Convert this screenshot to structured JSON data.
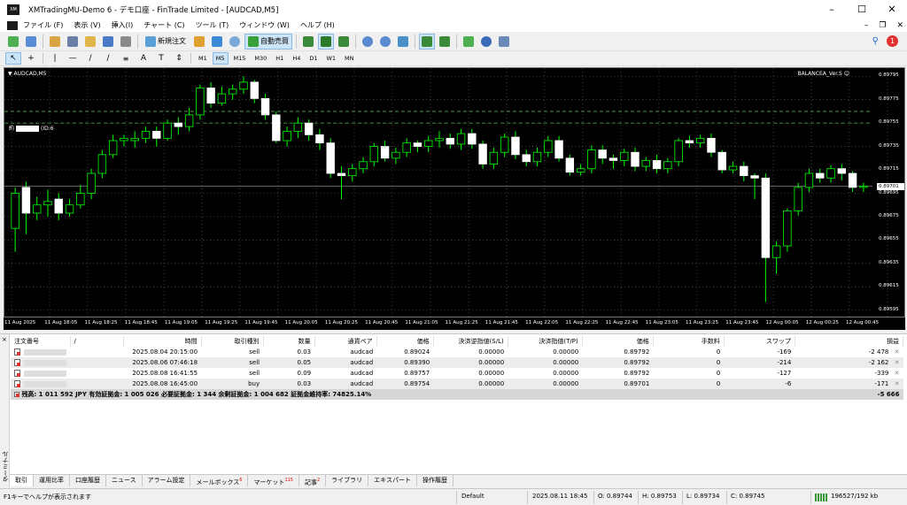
{
  "window": {
    "title": "XMTradingMU-Demo 6 - デモ口座 - FinTrade Limited - [AUDCAD,M5]",
    "app_icon_text": "XM"
  },
  "menu": [
    "ファイル (F)",
    "表示 (V)",
    "挿入(I)",
    "チャート (C)",
    "ツール (T)",
    "ウィンドウ (W)",
    "ヘルプ (H)"
  ],
  "toolbar": {
    "new_order": "新規注文",
    "auto_trading": "自動売買"
  },
  "timeframes": [
    "M1",
    "M5",
    "M15",
    "M30",
    "H1",
    "H4",
    "D1",
    "W1",
    "MN"
  ],
  "active_timeframe": "M5",
  "chart": {
    "symbol_label": "AUDCAD,M5",
    "ea_label": "BALANCEA_Ver.S ☺",
    "object_label": "約",
    "object_label_suffix": "(ID:6",
    "current_price": "0.89701",
    "price_ticks": [
      "0.89795",
      "0.89775",
      "0.89755",
      "0.89735",
      "0.89715",
      "0.89695",
      "0.89675",
      "0.89655",
      "0.89635",
      "0.89615",
      "0.89595"
    ],
    "time_labels": [
      "11 Aug 2025",
      "11 Aug 18:05",
      "11 Aug 18:25",
      "11 Aug 18:45",
      "11 Aug 19:05",
      "11 Aug 19:25",
      "11 Aug 19:45",
      "11 Aug 20:05",
      "11 Aug 20:25",
      "11 Aug 20:45",
      "11 Aug 21:05",
      "11 Aug 21:25",
      "11 Aug 21:45",
      "11 Aug 22:05",
      "11 Aug 22:25",
      "11 Aug 22:45",
      "11 Aug 23:05",
      "11 Aug 23:25",
      "11 Aug 23:45",
      "12 Aug 00:05",
      "12 Aug 00:25",
      "12 Aug 00:45"
    ]
  },
  "chart_data": {
    "type": "candlestick",
    "title": "AUDCAD,M5",
    "ylim": [
      0.89588,
      0.89802
    ],
    "hlines": [
      0.89765,
      0.89755,
      0.89701
    ],
    "candles": [
      [
        0.89665,
        0.89695,
        0.89645,
        0.897
      ],
      [
        0.897,
        0.89678,
        0.8966,
        0.89705
      ],
      [
        0.89678,
        0.89685,
        0.89672,
        0.89692
      ],
      [
        0.89685,
        0.89688,
        0.89675,
        0.89698
      ],
      [
        0.8969,
        0.89678,
        0.89672,
        0.89695
      ],
      [
        0.89678,
        0.89685,
        0.89675,
        0.8969
      ],
      [
        0.89685,
        0.89695,
        0.89682,
        0.89702
      ],
      [
        0.89695,
        0.89712,
        0.8969,
        0.89716
      ],
      [
        0.89712,
        0.89728,
        0.89708,
        0.89732
      ],
      [
        0.89728,
        0.8974,
        0.89725,
        0.89745
      ],
      [
        0.8974,
        0.89742,
        0.89735,
        0.89745
      ],
      [
        0.8974,
        0.89742,
        0.89734,
        0.89748
      ],
      [
        0.89742,
        0.89748,
        0.89738,
        0.89752
      ],
      [
        0.89748,
        0.89742,
        0.89735,
        0.89752
      ],
      [
        0.89742,
        0.89755,
        0.8974,
        0.89758
      ],
      [
        0.89755,
        0.89752,
        0.89745,
        0.8976
      ],
      [
        0.89752,
        0.89762,
        0.89748,
        0.89768
      ],
      [
        0.89762,
        0.89785,
        0.89758,
        0.89788
      ],
      [
        0.89785,
        0.89772,
        0.89768,
        0.8979
      ],
      [
        0.89772,
        0.8978,
        0.8977,
        0.89786
      ],
      [
        0.8978,
        0.89784,
        0.89775,
        0.89788
      ],
      [
        0.89784,
        0.8979,
        0.8978,
        0.89795
      ],
      [
        0.8979,
        0.89776,
        0.89772,
        0.89792
      ],
      [
        0.89776,
        0.89762,
        0.89758,
        0.8978
      ],
      [
        0.89762,
        0.8974,
        0.89738,
        0.89765
      ],
      [
        0.8974,
        0.89748,
        0.89735,
        0.89752
      ],
      [
        0.89748,
        0.89755,
        0.89742,
        0.8976
      ],
      [
        0.89755,
        0.89745,
        0.8974,
        0.89758
      ],
      [
        0.89745,
        0.89738,
        0.89732,
        0.8975
      ],
      [
        0.89738,
        0.89712,
        0.89708,
        0.89742
      ],
      [
        0.89712,
        0.8971,
        0.8969,
        0.89718
      ],
      [
        0.8971,
        0.89716,
        0.89705,
        0.8972
      ],
      [
        0.89716,
        0.89722,
        0.89712,
        0.89726
      ],
      [
        0.89722,
        0.89735,
        0.89718,
        0.89738
      ],
      [
        0.89735,
        0.89725,
        0.89722,
        0.8974
      ],
      [
        0.89725,
        0.8973,
        0.8972,
        0.89734
      ],
      [
        0.8973,
        0.89738,
        0.89726,
        0.89742
      ],
      [
        0.89738,
        0.89735,
        0.8973,
        0.8974
      ],
      [
        0.89735,
        0.8974,
        0.8973,
        0.89744
      ],
      [
        0.8974,
        0.89742,
        0.89734,
        0.89748
      ],
      [
        0.89742,
        0.89737,
        0.89733,
        0.89746
      ],
      [
        0.89737,
        0.89746,
        0.89732,
        0.8975
      ],
      [
        0.89746,
        0.89737,
        0.89733,
        0.8975
      ],
      [
        0.89737,
        0.8972,
        0.89716,
        0.8974
      ],
      [
        0.8972,
        0.8973,
        0.89716,
        0.89734
      ],
      [
        0.8973,
        0.89743,
        0.89726,
        0.89746
      ],
      [
        0.89743,
        0.89728,
        0.89724,
        0.89748
      ],
      [
        0.89728,
        0.89722,
        0.89718,
        0.89732
      ],
      [
        0.89722,
        0.8973,
        0.89718,
        0.89734
      ],
      [
        0.8973,
        0.8974,
        0.89726,
        0.89744
      ],
      [
        0.8974,
        0.89725,
        0.89722,
        0.89744
      ],
      [
        0.89725,
        0.89713,
        0.8971,
        0.89728
      ],
      [
        0.89713,
        0.89716,
        0.8971,
        0.8972
      ],
      [
        0.89716,
        0.89732,
        0.89712,
        0.89736
      ],
      [
        0.89732,
        0.89725,
        0.8972,
        0.89736
      ],
      [
        0.89725,
        0.89723,
        0.89716,
        0.89728
      ],
      [
        0.89723,
        0.8973,
        0.89718,
        0.89733
      ],
      [
        0.8973,
        0.89718,
        0.89714,
        0.89734
      ],
      [
        0.89718,
        0.89723,
        0.89714,
        0.89726
      ],
      [
        0.89723,
        0.89716,
        0.89712,
        0.89728
      ],
      [
        0.89716,
        0.89722,
        0.89712,
        0.89725
      ],
      [
        0.89722,
        0.8974,
        0.89718,
        0.89742
      ],
      [
        0.8974,
        0.89738,
        0.89734,
        0.89744
      ],
      [
        0.89738,
        0.89742,
        0.89734,
        0.89745
      ],
      [
        0.89742,
        0.8973,
        0.89726,
        0.89746
      ],
      [
        0.8973,
        0.89715,
        0.89712,
        0.89732
      ],
      [
        0.89715,
        0.89718,
        0.89712,
        0.89722
      ],
      [
        0.89718,
        0.8971,
        0.89705,
        0.89722
      ],
      [
        0.8971,
        0.89708,
        0.8969,
        0.89712
      ],
      [
        0.89708,
        0.8964,
        0.89602,
        0.89712
      ],
      [
        0.8964,
        0.8965,
        0.89626,
        0.89654
      ],
      [
        0.8965,
        0.8968,
        0.89645,
        0.89682
      ],
      [
        0.8968,
        0.897,
        0.89676,
        0.89704
      ],
      [
        0.897,
        0.89712,
        0.89696,
        0.89716
      ],
      [
        0.89712,
        0.89708,
        0.89704,
        0.89716
      ],
      [
        0.89708,
        0.89716,
        0.89704,
        0.89719
      ],
      [
        0.89716,
        0.89712,
        0.89706,
        0.8972
      ],
      [
        0.89712,
        0.897,
        0.89696,
        0.89714
      ],
      [
        0.897,
        0.89701,
        0.89696,
        0.89704
      ]
    ]
  },
  "terminal": {
    "headers": [
      "注文番号",
      "/",
      "時間",
      "取引種別",
      "数量",
      "通貨ペア",
      "価格",
      "決済逆指値(S/L)",
      "決済指値(T/P)",
      "価格",
      "手数料",
      "スワップ",
      "損益"
    ],
    "rows": [
      {
        "time": "2025.08.04 20:15:00",
        "type": "sell",
        "size": "0.03",
        "symbol": "audcad",
        "price": "0.89024",
        "sl": "0.00000",
        "tp": "0.00000",
        "current": "0.89792",
        "commission": "0",
        "swap": "-169",
        "profit": "-2 478"
      },
      {
        "time": "2025.08.06 07:46:18",
        "type": "sell",
        "size": "0.05",
        "symbol": "audcad",
        "price": "0.89390",
        "sl": "0.00000",
        "tp": "0.00000",
        "current": "0.89792",
        "commission": "0",
        "swap": "-214",
        "profit": "-2 162"
      },
      {
        "time": "2025.08.08 16:41:55",
        "type": "sell",
        "size": "0.09",
        "symbol": "audcad",
        "price": "0.89757",
        "sl": "0.00000",
        "tp": "0.00000",
        "current": "0.89792",
        "commission": "0",
        "swap": "-127",
        "profit": "-339"
      },
      {
        "time": "2025.08.08 16:45:00",
        "type": "buy",
        "size": "0.03",
        "symbol": "audcad",
        "price": "0.89754",
        "sl": "0.00000",
        "tp": "0.00000",
        "current": "0.89701",
        "commission": "0",
        "swap": "-6",
        "profit": "-171"
      }
    ],
    "summary_text": "残高: 1 011 592 JPY  有効証拠金: 1 005 026  必要証拠金: 1 344  余剰証拠金: 1 004 682  証拠金維持率: 74825.14%",
    "summary_total": "-5 666",
    "side_label": "ターミナル",
    "close_mark": "×"
  },
  "tabs": [
    {
      "label": "取引",
      "badge": ""
    },
    {
      "label": "運用比率",
      "badge": ""
    },
    {
      "label": "口座履歴",
      "badge": ""
    },
    {
      "label": "ニュース",
      "badge": ""
    },
    {
      "label": "アラーム設定",
      "badge": ""
    },
    {
      "label": "メールボックス",
      "badge": "6"
    },
    {
      "label": "マーケット",
      "badge": "115"
    },
    {
      "label": "記事",
      "badge": "2"
    },
    {
      "label": "ライブラリ",
      "badge": ""
    },
    {
      "label": "エキスパート",
      "badge": ""
    },
    {
      "label": "操作履歴",
      "badge": ""
    }
  ],
  "status": {
    "help": "F1キーでヘルプが表示されます",
    "profile": "Default",
    "datetime": "2025.08.11 18:45",
    "open": "O: 0.89744",
    "high": "H: 0.89753",
    "low": "L: 0.89734",
    "close": "C: 0.89745",
    "traffic": "196527/192 kb"
  }
}
